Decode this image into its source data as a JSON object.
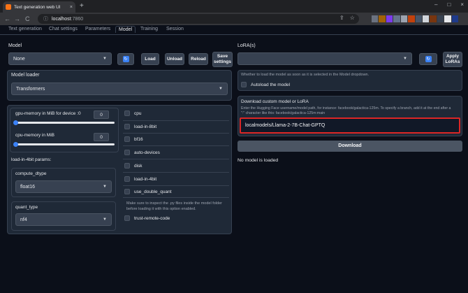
{
  "browser": {
    "tab_title": "Text generation web UI",
    "new_tab": "+",
    "tab_close": "×",
    "minimize": "–",
    "maximize": "□",
    "close": "×",
    "back": "←",
    "forward": "→",
    "reload": "C",
    "url_host": "localhost",
    "url_port": ":7860",
    "share_icon": "⇪",
    "star_icon": "☆",
    "extension_colors": [
      "#6b7280",
      "#a16207",
      "#7c3aed",
      "#64748b",
      "#9ca3af",
      "#c2410c",
      "#475569",
      "#d1d5db",
      "#78350f",
      "#374151",
      "#e5e7eb",
      "#1e3a8a"
    ]
  },
  "app_tabs": [
    "Text generation",
    "Chat settings",
    "Parameters",
    "Model",
    "Training",
    "Session"
  ],
  "model": {
    "label": "Model",
    "selected": "None",
    "load": "Load",
    "unload": "Unload",
    "reload": "Reload",
    "save_settings_line1": "Save",
    "save_settings_line2": "settings",
    "refresh_glyph": "↻"
  },
  "loader": {
    "label": "Model loader",
    "selected": "Transformers"
  },
  "gpu_memory": {
    "label": "gpu-memory in MiB for device :0",
    "value": "0",
    "fraction": 0
  },
  "cpu_memory": {
    "label": "cpu-memory in MiB",
    "value": "0",
    "fraction": 0
  },
  "checkboxes": [
    "cpu",
    "load-in-8bit",
    "bf16",
    "auto-devices",
    "disk",
    "load-in-4bit",
    "use_double_quant",
    "trust-remote-code"
  ],
  "params_4bit": {
    "label": "load-in-4bit params:"
  },
  "compute_dtype": {
    "label": "compute_dtype",
    "selected": "float16"
  },
  "quant_type": {
    "label": "quant_type",
    "selected": "nf4"
  },
  "inspect_note_line1": "Make sure to inspect the .py files inside the model folder",
  "inspect_note_line2": "before loading it with this option enabled.",
  "lora": {
    "label": "LoRA(s)",
    "selected": "",
    "apply_line1": "Apply",
    "apply_line2": "LoRAs"
  },
  "autoload": {
    "info": "Whether to load the model as soon as it is selected in the Model dropdown.",
    "label": "Autoload the model"
  },
  "download": {
    "title": "Download custom model or LoRA",
    "help_line1": "Enter the Hugging Face username/model path, for instance: facebook/galactica-125m. To specify a branch, add it at the end after a",
    "help_line2": "\":\" character like this: facebook/galactica-125m:main",
    "value": "localmodels/Llama-2-7B-Chat-GPTQ",
    "button": "Download",
    "highlight_color": "#dc2626"
  },
  "status": "No model is loaded"
}
